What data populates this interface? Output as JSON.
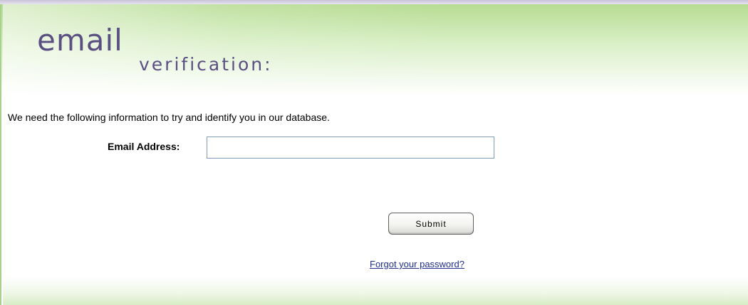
{
  "header": {
    "title_main": "email",
    "title_sub": "verification:"
  },
  "form": {
    "intro_text": "We need the following information to try and identify you in our database.",
    "email_label": "Email Address:",
    "email_value": "",
    "submit_label": "Submit",
    "forgot_link": "Forgot your password?"
  },
  "colors": {
    "title": "#5a4f82",
    "header_green": "#b6dc92",
    "link": "#1f2e8c",
    "border_green": "#a9d08e"
  }
}
